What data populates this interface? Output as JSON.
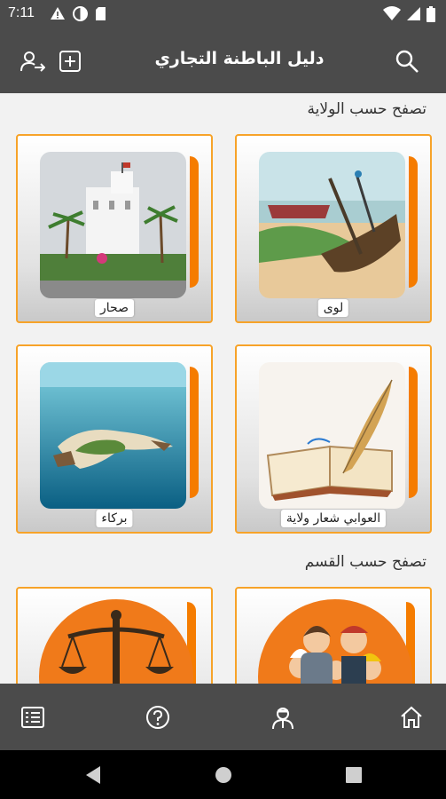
{
  "status_bar": {
    "time": "7:11",
    "icons_left": [
      "warning-icon",
      "data-saver-icon",
      "sd-card-icon"
    ],
    "icons_right": [
      "wifi-icon",
      "cell-signal-icon",
      "battery-icon"
    ]
  },
  "app_bar": {
    "title": "دليل الباطنة التجاري",
    "icons": [
      "search-icon",
      "add-box-icon",
      "share-user-icon"
    ]
  },
  "sections": {
    "by_wilayat": "تصفح حسب الولاية",
    "by_category": "تصفح حسب القسم"
  },
  "wilayat_cards": [
    {
      "label": "لوى",
      "image": "boat-on-beach"
    },
    {
      "label": "صحار",
      "image": "sohar-fort"
    },
    {
      "label": "العوابي شعار ولاية",
      "image": "book-and-quill"
    },
    {
      "label": "بركاء",
      "image": "island-aerial"
    }
  ],
  "category_cards": [
    {
      "label": "",
      "image": "community-people"
    },
    {
      "label": "",
      "image": "justice-scales"
    }
  ],
  "bottom_nav": [
    "home-icon",
    "agent-icon",
    "help-icon",
    "list-icon"
  ],
  "system_nav": [
    "back-button",
    "home-button",
    "recents-button"
  ],
  "colors": {
    "accent": "#f7a329",
    "bar": "#4b4b4b",
    "circle_orange": "#f07a1a"
  }
}
